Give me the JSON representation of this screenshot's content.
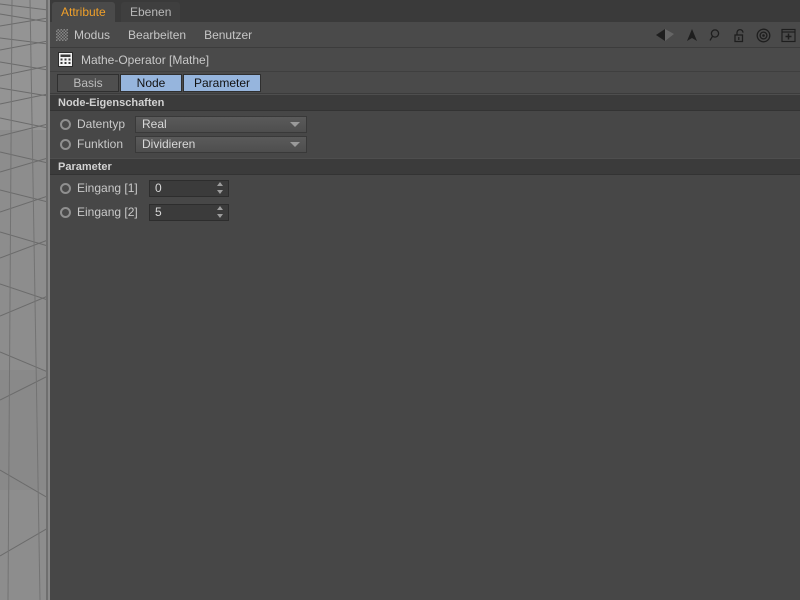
{
  "viewport": {
    "name": "perspective-viewport"
  },
  "tabs": [
    {
      "label": "Attribute",
      "state": "active"
    },
    {
      "label": "Ebenen",
      "state": "inactive"
    }
  ],
  "menubar": {
    "grip_icon": "grip-dots-icon",
    "items": [
      "Modus",
      "Bearbeiten",
      "Benutzer"
    ],
    "icons": [
      "back-arrow-icon",
      "up-arrow-icon",
      "search-icon",
      "lock-icon",
      "target-icon",
      "plus-icon"
    ]
  },
  "object": {
    "icon": "math-operator-icon",
    "title": "Mathe-Operator [Mathe]"
  },
  "mode_tabs": [
    {
      "label": "Basis",
      "selected": false
    },
    {
      "label": "Node",
      "selected": true
    },
    {
      "label": "Parameter",
      "selected": true
    }
  ],
  "sections": [
    {
      "title": "Node-Eigenschaften",
      "rows": [
        {
          "label": "Datentyp",
          "type": "dropdown",
          "value": "Real"
        },
        {
          "label": "Funktion",
          "type": "dropdown",
          "value": "Dividieren"
        }
      ]
    },
    {
      "title": "Parameter",
      "rows": [
        {
          "label": "Eingang [1]",
          "type": "number",
          "value": "0"
        },
        {
          "label": "Eingang [2]",
          "type": "number",
          "value": "5"
        }
      ]
    }
  ],
  "colors": {
    "panel_bg": "#474747",
    "section_bg": "#3b3b3b",
    "tab_active_text": "#f0a02a",
    "tab_selected_bg": "#96b5dd",
    "field_text": "#d8d8d8"
  }
}
